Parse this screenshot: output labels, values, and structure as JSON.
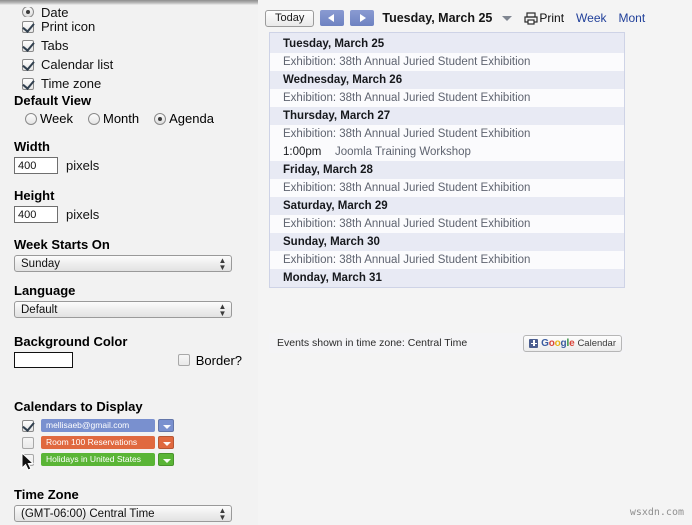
{
  "config": {
    "display_checkboxes": [
      {
        "label": "Date",
        "checked": true,
        "clipped": true,
        "type": "radio"
      },
      {
        "label": "Print icon",
        "checked": true
      },
      {
        "label": "Tabs",
        "checked": true
      },
      {
        "label": "Calendar list",
        "checked": true
      },
      {
        "label": "Time zone",
        "checked": true
      }
    ],
    "default_view": {
      "title": "Default View",
      "options": [
        {
          "label": "Week",
          "selected": false
        },
        {
          "label": "Month",
          "selected": false
        },
        {
          "label": "Agenda",
          "selected": true
        }
      ]
    },
    "width": {
      "title": "Width",
      "value": "400",
      "unit": "pixels"
    },
    "height": {
      "title": "Height",
      "value": "400",
      "unit": "pixels"
    },
    "week_starts_on": {
      "title": "Week Starts On",
      "value": "Sunday"
    },
    "language": {
      "title": "Language",
      "value": "Default"
    },
    "background_color": {
      "title": "Background Color",
      "swatch": "#ffffff"
    },
    "border": {
      "label": "Border?",
      "checked": false
    },
    "calendars_to_display": {
      "title": "Calendars to Display",
      "items": [
        {
          "name": "mellisaeb@gmail.com",
          "color": "#7990cf",
          "checked": true
        },
        {
          "name": "Room 100 Reservations",
          "color": "#e0693f",
          "checked": false
        },
        {
          "name": "Holidays in United States",
          "color": "#5ab536",
          "checked": false
        }
      ]
    },
    "time_zone": {
      "title": "Time Zone",
      "value": "(GMT-06:00) Central Time"
    }
  },
  "calendar": {
    "toolbar": {
      "today_label": "Today",
      "prev_icon": "chevron-left-icon",
      "next_icon": "chevron-right-icon",
      "date_title": "Tuesday, March 25",
      "dropdown_icon": "caret-down-icon",
      "print_icon": "printer-icon",
      "print_label": "Print",
      "tabs": [
        "Week",
        "Mont"
      ]
    },
    "agenda": [
      {
        "date": "Tuesday, March 25",
        "events": [
          {
            "time": "",
            "title": "Exhibition: 38th Annual Juried Student Exhibition"
          }
        ]
      },
      {
        "date": "Wednesday, March 26",
        "events": [
          {
            "time": "",
            "title": "Exhibition: 38th Annual Juried Student Exhibition"
          }
        ]
      },
      {
        "date": "Thursday, March 27",
        "events": [
          {
            "time": "",
            "title": "Exhibition: 38th Annual Juried Student Exhibition"
          },
          {
            "time": "1:00pm",
            "title": "Joomla Training Workshop"
          }
        ]
      },
      {
        "date": "Friday, March 28",
        "events": [
          {
            "time": "",
            "title": "Exhibition: 38th Annual Juried Student Exhibition"
          }
        ]
      },
      {
        "date": "Saturday, March 29",
        "events": [
          {
            "time": "",
            "title": "Exhibition: 38th Annual Juried Student Exhibition"
          }
        ]
      },
      {
        "date": "Sunday, March 30",
        "events": [
          {
            "time": "",
            "title": "Exhibition: 38th Annual Juried Student Exhibition"
          }
        ]
      },
      {
        "date": "Monday, March 31",
        "events": []
      }
    ],
    "footer": {
      "timezone_note": "Events shown in time zone: Central Time",
      "badge": {
        "plus_icon": "plus-square-icon",
        "brand": "Google",
        "label": "Calendar"
      }
    }
  },
  "watermark": "wsxdn.com"
}
